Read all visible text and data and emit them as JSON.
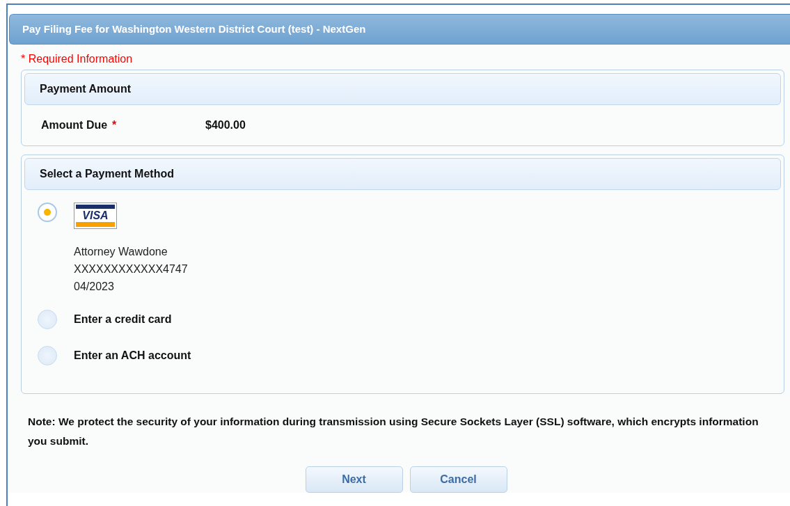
{
  "window": {
    "title": "Pay Filing Fee for Washington Western District Court (test) - NextGen"
  },
  "required_note": "* Required Information",
  "payment_amount": {
    "heading": "Payment Amount",
    "label": "Amount Due",
    "required_mark": "*",
    "value": "$400.00"
  },
  "payment_method": {
    "heading": "Select a Payment Method",
    "options": [
      {
        "kind": "saved_card",
        "selected": true,
        "brand": "VISA",
        "lines": [
          "Attorney Wawdone",
          "XXXXXXXXXXXX4747",
          "04/2023"
        ]
      },
      {
        "kind": "option",
        "selected": false,
        "label": "Enter a credit card"
      },
      {
        "kind": "option",
        "selected": false,
        "label": "Enter an ACH account"
      }
    ]
  },
  "security_note": "Note: We protect the security of your information during transmission using Secure Sockets Layer (SSL) software, which encrypts information you submit.",
  "buttons": [
    "Next",
    "Cancel"
  ]
}
